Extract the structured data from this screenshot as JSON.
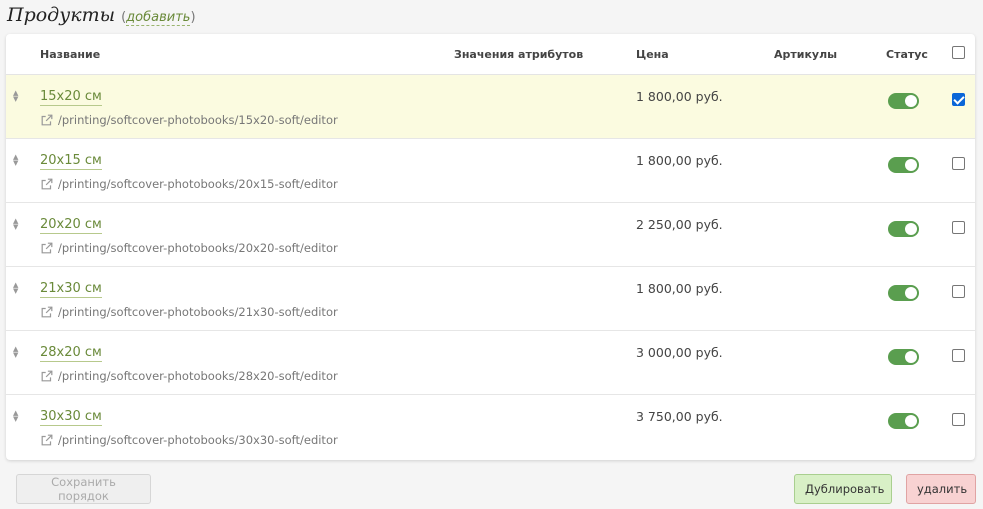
{
  "header": {
    "title": "Продукты",
    "add_link": "добавить"
  },
  "table": {
    "columns": {
      "name": "Название",
      "attributes": "Значения атрибутов",
      "price": "Цена",
      "sku": "Артикулы",
      "status": "Статус"
    },
    "rows": [
      {
        "name": "15x20 см",
        "url": "/printing/softcover-photobooks/15x20-soft/editor",
        "price": "1 800,00 руб.",
        "status_on": true,
        "checked": true
      },
      {
        "name": "20x15 см",
        "url": "/printing/softcover-photobooks/20x15-soft/editor",
        "price": "1 800,00 руб.",
        "status_on": true,
        "checked": false
      },
      {
        "name": "20x20 см",
        "url": "/printing/softcover-photobooks/20x20-soft/editor",
        "price": "2 250,00 руб.",
        "status_on": true,
        "checked": false
      },
      {
        "name": "21x30 см",
        "url": "/printing/softcover-photobooks/21x30-soft/editor",
        "price": "1 800,00 руб.",
        "status_on": true,
        "checked": false
      },
      {
        "name": "28x20 см",
        "url": "/printing/softcover-photobooks/28x20-soft/editor",
        "price": "3 000,00 руб.",
        "status_on": true,
        "checked": false
      },
      {
        "name": "30x30 см",
        "url": "/printing/softcover-photobooks/30x30-soft/editor",
        "price": "3 750,00 руб.",
        "status_on": true,
        "checked": false
      }
    ]
  },
  "actions": {
    "save_order": "Сохранить порядок",
    "duplicate": "Дублировать",
    "delete": "удалить"
  },
  "icons": {
    "drag": "drag-handle-icon",
    "external": "external-link-icon"
  },
  "colors": {
    "link_green": "#6a8a3a",
    "toggle_on": "#5a9e4f",
    "selected_row": "#fbfbe0",
    "checkbox_blue": "#0a66d8",
    "duplicate_bg": "#d8f0c6",
    "delete_bg": "#f8d2d2"
  }
}
